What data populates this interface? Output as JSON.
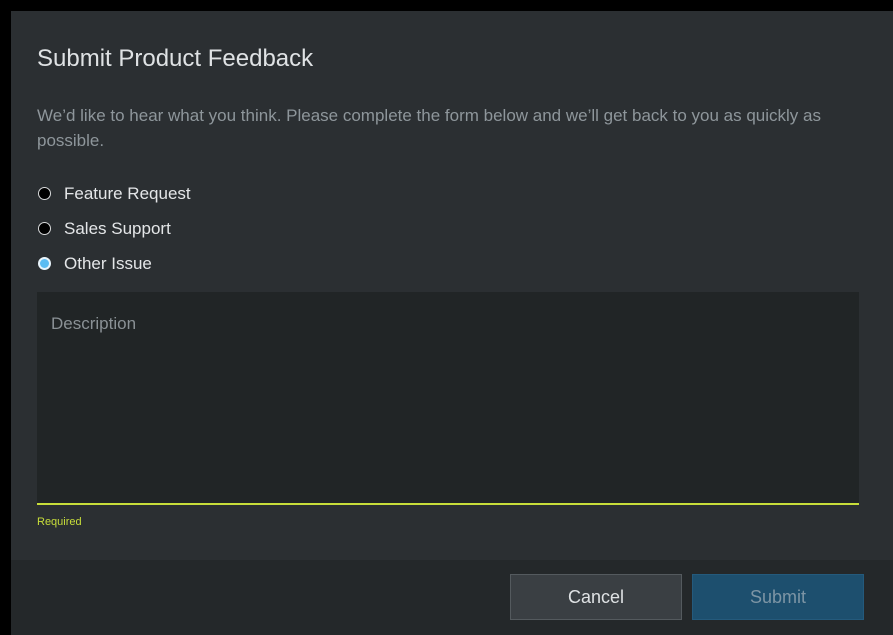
{
  "dialog": {
    "title": "Submit Product Feedback",
    "intro": "We’d like to hear what you think. Please complete the form below and we’ll get back to you as quickly as possible."
  },
  "options": [
    {
      "label": "Feature Request",
      "checked": false
    },
    {
      "label": "Sales Support",
      "checked": false
    },
    {
      "label": "Other Issue",
      "checked": true
    }
  ],
  "description": {
    "placeholder": "Description",
    "value": "",
    "helper": "Required"
  },
  "footer": {
    "cancel_label": "Cancel",
    "submit_label": "Submit"
  },
  "colors": {
    "accent": "#5bbcf2",
    "required": "#c8de3a",
    "submit_bg": "#1d4f6e"
  }
}
